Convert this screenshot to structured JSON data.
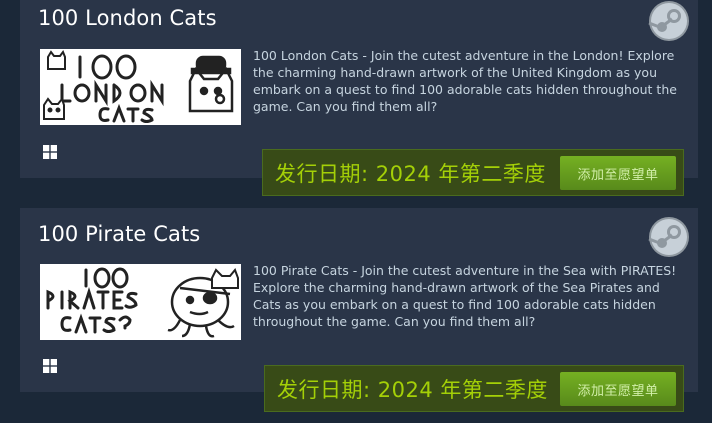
{
  "items": [
    {
      "title": "100 London Cats",
      "description": "100 London Cats - Join the cutest adventure in the London! Explore the charming hand-drawn artwork of the United Kingdom as you embark on a quest to find 100 adorable cats hidden throughout the game. Can you find them all?",
      "thumbnail_text": "100 LONDON CATS",
      "platform": "windows-icon",
      "release": "发行日期: 2024 年第二季度",
      "wishlist_label": "添加至愿望单"
    },
    {
      "title": "100 Pirate Cats",
      "description": "100 Pirate Cats - Join the cutest adventure in the Sea with PIRATES! Explore the charming hand-drawn artwork of the Sea Pirates and Cats as you embark on a quest to find 100 adorable cats hidden throughout the game. Can you find them all?",
      "thumbnail_text": "100 PIRATES CATS",
      "platform": "windows-icon",
      "release": "发行日期: 2024 年第二季度",
      "wishlist_label": "添加至愿望单"
    }
  ],
  "colors": {
    "background": "#1b2838",
    "card": "#2a3548",
    "release_text": "#a4d007",
    "button": "#75b022"
  }
}
